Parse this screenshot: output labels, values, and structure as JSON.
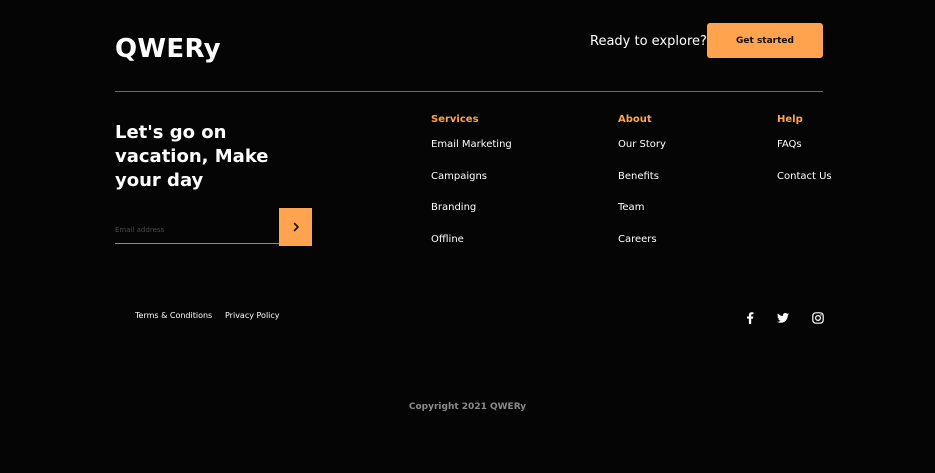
{
  "brand": {
    "logo": "QWERy"
  },
  "header": {
    "cta_text": "Ready to explore?",
    "cta_button": "Get started"
  },
  "newsletter": {
    "tagline": "Let's go on vacation, Make your day",
    "email_placeholder": "Email address",
    "submit_icon": "chevron-right-icon"
  },
  "columns": [
    {
      "heading": "Services",
      "links": [
        "Email Marketing",
        "Campaigns",
        "Branding",
        "Offline"
      ]
    },
    {
      "heading": "About",
      "links": [
        "Our Story",
        "Benefits",
        "Team",
        "Careers"
      ]
    },
    {
      "heading": "Help",
      "links": [
        "FAQs",
        "Contact Us"
      ]
    }
  ],
  "legal": {
    "terms": "Terms & Conditions",
    "privacy": "Privacy Policy"
  },
  "social": [
    "facebook-icon",
    "twitter-icon",
    "instagram-icon"
  ],
  "footer": {
    "copyright": "Copyright 2021 QWERy"
  },
  "colors": {
    "accent": "#FFA34F",
    "background": "#050505",
    "divider": "#6b6b6b",
    "muted": "#8a8a8a"
  }
}
